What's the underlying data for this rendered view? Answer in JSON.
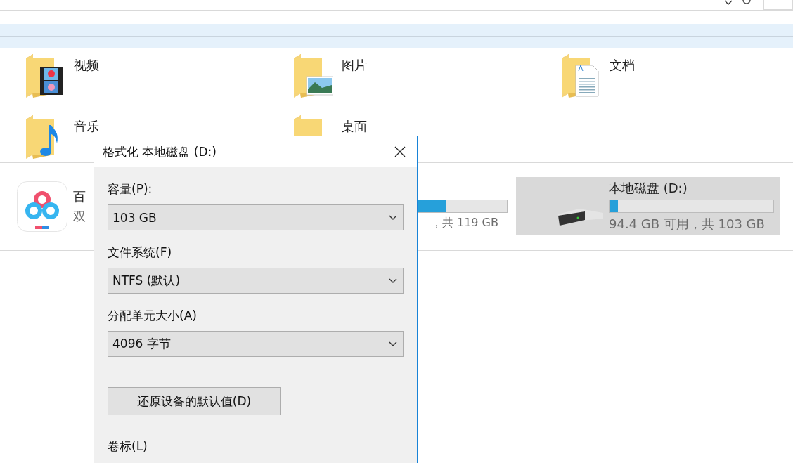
{
  "folders": [
    {
      "name": "视频",
      "kind": "video"
    },
    {
      "name": "图片",
      "kind": "pictures"
    },
    {
      "name": "文档",
      "kind": "documents"
    },
    {
      "name": "音乐",
      "kind": "music"
    },
    {
      "name": "桌面",
      "kind": "desktop"
    }
  ],
  "devices": [
    {
      "kind": "app",
      "name": "百",
      "subtitle": "双",
      "selected": false
    },
    {
      "kind": "drive",
      "level": 0.64,
      "usage": "，共 119 GB",
      "selected": false
    },
    {
      "kind": "drive",
      "name": "本地磁盘 (D:)",
      "level": 0.05,
      "usage": "94.4 GB 可用，共 103 GB",
      "selected": true
    }
  ],
  "dialog": {
    "title": "格式化 本地磁盘 (D:)",
    "fields": [
      {
        "label": "容量(P):",
        "value": "103 GB"
      },
      {
        "label": "文件系统(F)",
        "value": "NTFS (默认)"
      },
      {
        "label": "分配单元大小(A)",
        "value": "4096 字节"
      }
    ],
    "restore_button": "还原设备的默认值(D)",
    "volume_label": "卷标(L)"
  }
}
